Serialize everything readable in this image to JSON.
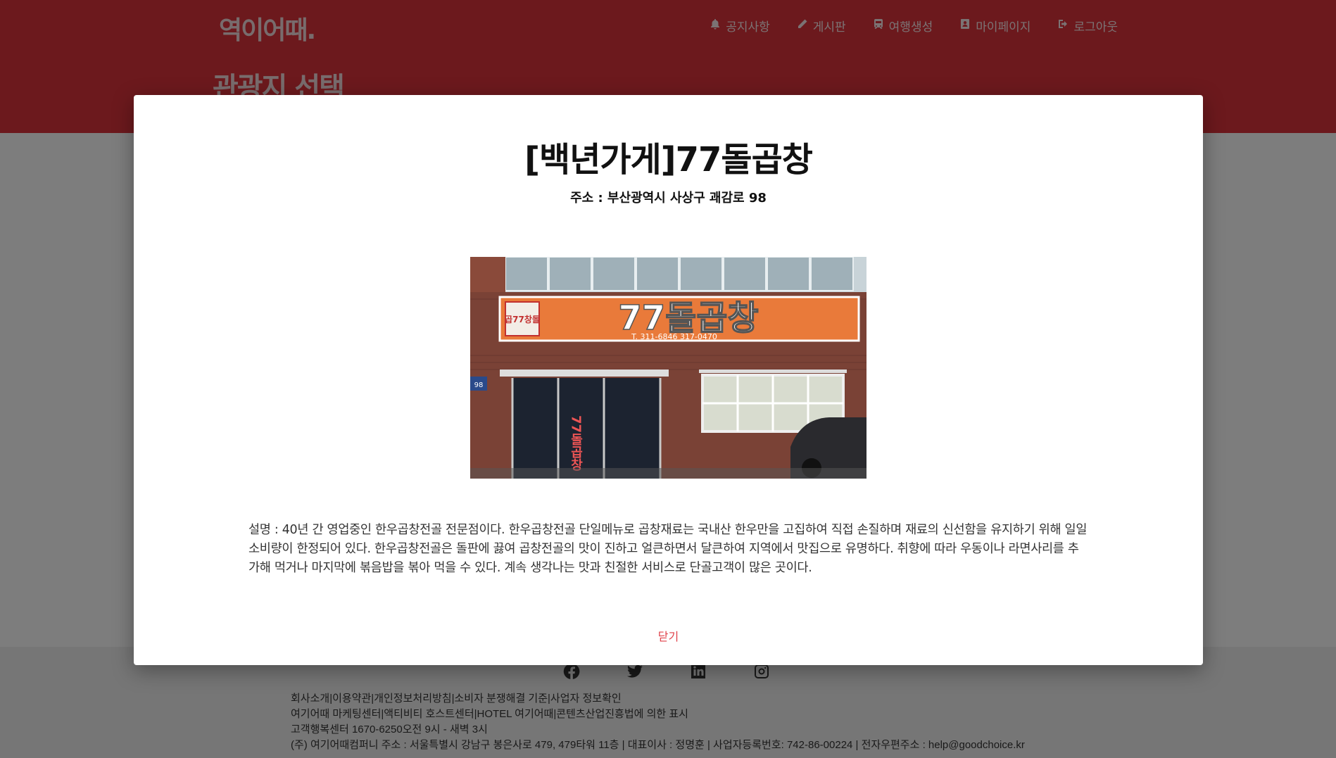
{
  "header": {
    "brand": "역이어때.",
    "page_title": "관광지 선택",
    "nav": [
      {
        "label": "공지사항",
        "icon": "bell-icon"
      },
      {
        "label": "게시판",
        "icon": "pencil-icon"
      },
      {
        "label": "여행생성",
        "icon": "train-icon"
      },
      {
        "label": "마이페이지",
        "icon": "user-badge-icon"
      },
      {
        "label": "로그아웃",
        "icon": "logout-icon"
      }
    ]
  },
  "footer": {
    "social": [
      "facebook-icon",
      "twitter-icon",
      "linkedin-icon",
      "instagram-icon"
    ],
    "lines": [
      "회사소개|이용약관|개인정보처리방침|소비자 분쟁해결 기준|사업자 정보확인",
      "여기어때 마케팅센터|액티비티 호스트센터|HOTEL 여기어때|콘텐츠산업진흥법에 의한 표시",
      "고객행복센터 1670-6250오전 9시 - 새벽 3시",
      "(주) 여기어때컴퍼니 주소 : 서울특별시 강남구 봉은사로 479, 479타워 11층 | 대표이사 : 정명훈 | 사업자등록번호: 742-86-00224 | 전자우편주소 : help@goodchoice.kr"
    ]
  },
  "modal": {
    "title": "[백년가게]77돌곱창",
    "address": "주소 : 부산광역시 사상구 괘감로 98",
    "photo": {
      "sign_text": "77돌곱창",
      "sign_badge": "곱77창돌",
      "sign_phone": "T. 311-6846    317-0470",
      "door_text": "77돌곱창",
      "building_number": "98"
    },
    "description": "설명 : 40년 간 영업중인 한우곱창전골 전문점이다. 한우곱창전골 단일메뉴로 곱창재료는 국내산 한우만을 고집하여 직접 손질하며 재료의 신선함을 유지하기 위해 일일 소비량이 한정되어 있다. 한우곱창전골은 돌판에 끓여 곱창전골의 맛이 진하고 얼큰하면서 달큰하여 지역에서 맛집으로 유명하다. 취향에 따라 우동이나 라면사리를 추가해 먹거나 마지막에 볶음밥을 볶아 먹을 수 있다. 계속 생각나는 맛과 친절한 서비스로 단골고객이 많은 곳이다.",
    "close_label": "닫기"
  },
  "colors": {
    "header_red": "#d9323a",
    "close_red": "#e0424a"
  }
}
